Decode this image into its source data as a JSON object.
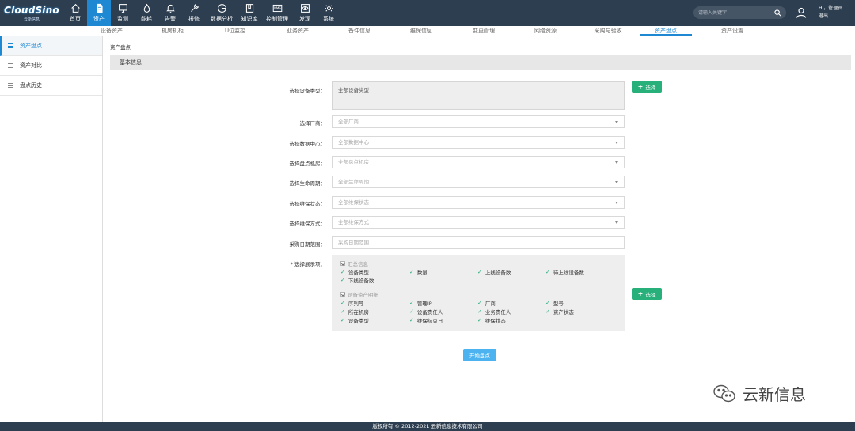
{
  "brand": {
    "name": "CloudSino",
    "sub": "云新信息"
  },
  "nav": [
    {
      "label": "首页",
      "icon": "home-icon"
    },
    {
      "label": "资产",
      "icon": "document-icon",
      "active": true
    },
    {
      "label": "监测",
      "icon": "monitor-icon"
    },
    {
      "label": "能耗",
      "icon": "drop-icon"
    },
    {
      "label": "告警",
      "icon": "bell-icon"
    },
    {
      "label": "报修",
      "icon": "wrench-icon"
    },
    {
      "label": "数据分析",
      "icon": "pie-chart-icon"
    },
    {
      "label": "知识库",
      "icon": "book-icon"
    },
    {
      "label": "控制管理",
      "icon": "bms-icon"
    },
    {
      "label": "发现",
      "icon": "eye-icon"
    },
    {
      "label": "系统",
      "icon": "gear-icon"
    }
  ],
  "bms_text": "BMS",
  "search": {
    "placeholder": "请输入关键字"
  },
  "user": {
    "greeting": "Hi，管理员",
    "logout": "退出"
  },
  "subnav": [
    "设备资产",
    "机房机柜",
    "U位监控",
    "业务资产",
    "备件信息",
    "维保信息",
    "变更管理",
    "网络资源",
    "采购与验收",
    "资产盘点",
    "资产设置"
  ],
  "sidebar": [
    {
      "label": "资产盘点",
      "active": true
    },
    {
      "label": "资产对比"
    },
    {
      "label": "盘点历史"
    }
  ],
  "breadcrumb": "资产盘点",
  "panel_title": "基本信息",
  "form": {
    "device_type": {
      "label": "选择设备类型：",
      "value": "全部设备类型"
    },
    "choose_btn": "选择",
    "fields": [
      {
        "label": "选择厂商：",
        "placeholder": "全部厂商"
      },
      {
        "label": "选择数据中心：",
        "placeholder": "全部数据中心"
      },
      {
        "label": "选择盘点机房：",
        "placeholder": "全部盘点机房"
      },
      {
        "label": "选择生命周期：",
        "placeholder": "全部生命周期"
      },
      {
        "label": "选择维保状态：",
        "placeholder": "全部维保状态"
      },
      {
        "label": "选择维保方式：",
        "placeholder": "全部维保方式"
      }
    ],
    "purchase_date": {
      "label": "采购日期范围：",
      "placeholder": "采购日期范围"
    },
    "display_label": "* 选择展示项：",
    "summary_group": "汇总信息",
    "summary_items": [
      "设备类型",
      "数量",
      "上线设备数",
      "待上线设备数",
      "下线设备数"
    ],
    "detail_group": "设备资产明细",
    "detail_items": [
      "序列号",
      "管理IP",
      "厂商",
      "型号",
      "所在机房",
      "设备责任人",
      "业务责任人",
      "资产状态",
      "设备类型",
      "维保结束日",
      "维保状态"
    ]
  },
  "start_btn": "开始盘点",
  "watermark": "云新信息",
  "footer": "版权所有 © 2012-2021  云新信息技术有限公司"
}
